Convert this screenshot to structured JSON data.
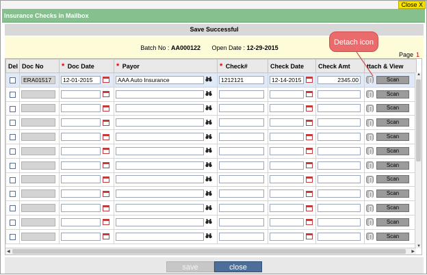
{
  "window": {
    "close_label": "Close X",
    "title": "Insurance Checks in Mailbox"
  },
  "status": {
    "message": "Save Successful"
  },
  "batch": {
    "no_label": "Batch No :",
    "no_value": "AA000122",
    "date_label": "Open Date :",
    "date_value": "12-29-2015",
    "page_label": "Page",
    "page_value": "1"
  },
  "columns": {
    "del": "Del",
    "doc_no": "Doc No",
    "doc_date": "Doc Date",
    "payor": "Payor",
    "check_no": "Check#",
    "check_date": "Check Date",
    "check_amt": "Check Amt",
    "attach_view": "ttach & View"
  },
  "rows": [
    {
      "doc_no": "ERA01517",
      "doc_date": "12-01-2015",
      "payor": "AAA Auto Insurance",
      "check_no": "1212121",
      "check_date": "12-14-2015",
      "check_amt": "2345.00",
      "scan": "Scan"
    },
    {
      "doc_no": "",
      "doc_date": "",
      "payor": "",
      "check_no": "",
      "check_date": "",
      "check_amt": "",
      "scan": "Scan"
    },
    {
      "doc_no": "",
      "doc_date": "",
      "payor": "",
      "check_no": "",
      "check_date": "",
      "check_amt": "",
      "scan": "Scan"
    },
    {
      "doc_no": "",
      "doc_date": "",
      "payor": "",
      "check_no": "",
      "check_date": "",
      "check_amt": "",
      "scan": "Scan"
    },
    {
      "doc_no": "",
      "doc_date": "",
      "payor": "",
      "check_no": "",
      "check_date": "",
      "check_amt": "",
      "scan": "Scan"
    },
    {
      "doc_no": "",
      "doc_date": "",
      "payor": "",
      "check_no": "",
      "check_date": "",
      "check_amt": "",
      "scan": "Scan"
    },
    {
      "doc_no": "",
      "doc_date": "",
      "payor": "",
      "check_no": "",
      "check_date": "",
      "check_amt": "",
      "scan": "Scan"
    },
    {
      "doc_no": "",
      "doc_date": "",
      "payor": "",
      "check_no": "",
      "check_date": "",
      "check_amt": "",
      "scan": "Scan"
    },
    {
      "doc_no": "",
      "doc_date": "",
      "payor": "",
      "check_no": "",
      "check_date": "",
      "check_amt": "",
      "scan": "Scan"
    },
    {
      "doc_no": "",
      "doc_date": "",
      "payor": "",
      "check_no": "",
      "check_date": "",
      "check_amt": "",
      "scan": "Scan"
    },
    {
      "doc_no": "",
      "doc_date": "",
      "payor": "",
      "check_no": "",
      "check_date": "",
      "check_amt": "",
      "scan": "Scan"
    },
    {
      "doc_no": "",
      "doc_date": "",
      "payor": "",
      "check_no": "",
      "check_date": "",
      "check_amt": "",
      "scan": "Scan"
    }
  ],
  "footer": {
    "save_label": "save",
    "close_label": "close"
  },
  "callout": {
    "text": "Detach icon"
  },
  "icons": {
    "calendar": "calendar-icon",
    "payor_lookup": "binoculars-icon",
    "attach": "attach-icon"
  },
  "colors": {
    "title_bar": "#86c08e",
    "close_x": "#f5e200",
    "close_button": "#4b6f98",
    "callout": "#e96b6b",
    "required": "#e00000"
  }
}
